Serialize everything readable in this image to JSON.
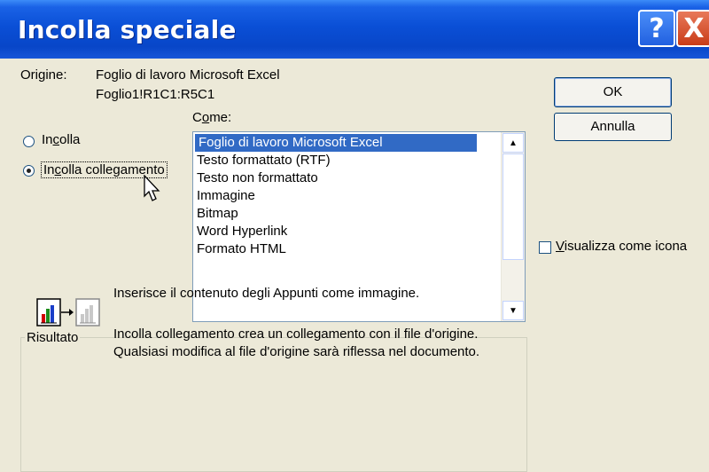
{
  "window": {
    "title": "Incolla speciale",
    "help_label": "?",
    "close_label": "X"
  },
  "source": {
    "label": "Origine:",
    "line1": "Foglio di lavoro Microsoft Excel",
    "line2": "Foglio1!R1C1:R5C1"
  },
  "as": {
    "label_prefix": "C",
    "label_accel": "o",
    "label_rest": "me:"
  },
  "options": {
    "paste_prefix": "In",
    "paste_accel": "c",
    "paste_rest": "olla",
    "link_prefix": "In",
    "link_accel": "c",
    "link_rest": "olla collegamento",
    "selected": "Incolla collegamento"
  },
  "formats": {
    "items": [
      "Foglio di lavoro Microsoft Excel",
      "Testo formattato (RTF)",
      "Testo non formattato",
      "Immagine",
      "Bitmap",
      "Word Hyperlink",
      "Formato HTML"
    ],
    "selected": "Foglio di lavoro Microsoft Excel"
  },
  "buttons": {
    "ok": "OK",
    "cancel": "Annulla"
  },
  "display_as_icon": {
    "accel": "V",
    "rest": "isualizza come icona",
    "checked": false
  },
  "result": {
    "title": "Risultato",
    "line1": "Inserisce il contenuto degli Appunti come immagine.",
    "line2": "Incolla collegamento crea un collegamento con il file d'origine. Qualsiasi modifica al file d'origine sarà riflessa nel documento."
  }
}
